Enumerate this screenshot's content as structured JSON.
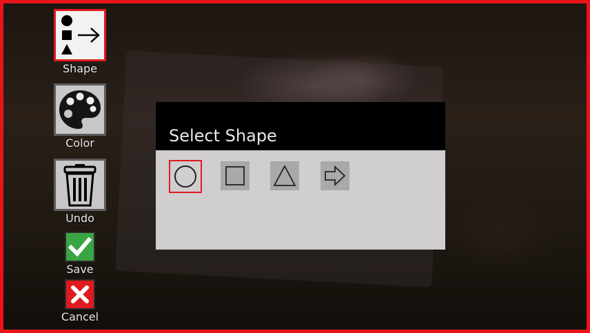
{
  "toolbar": {
    "shape_label": "Shape",
    "color_label": "Color",
    "undo_label": "Undo",
    "save_label": "Save",
    "cancel_label": "Cancel"
  },
  "dialog": {
    "title": "Select Shape",
    "options": [
      {
        "icon": "circle-icon",
        "selected": true
      },
      {
        "icon": "square-icon",
        "selected": false
      },
      {
        "icon": "triangle-icon",
        "selected": false
      },
      {
        "icon": "arrow-right-icon",
        "selected": false
      }
    ]
  },
  "colors": {
    "border": "#e8141a",
    "selected_outline": "#e01a1f",
    "save_green": "#3aa543",
    "cancel_red": "#e01a1f",
    "dialog_header": "#000000",
    "dialog_body": "#d0cecf"
  }
}
